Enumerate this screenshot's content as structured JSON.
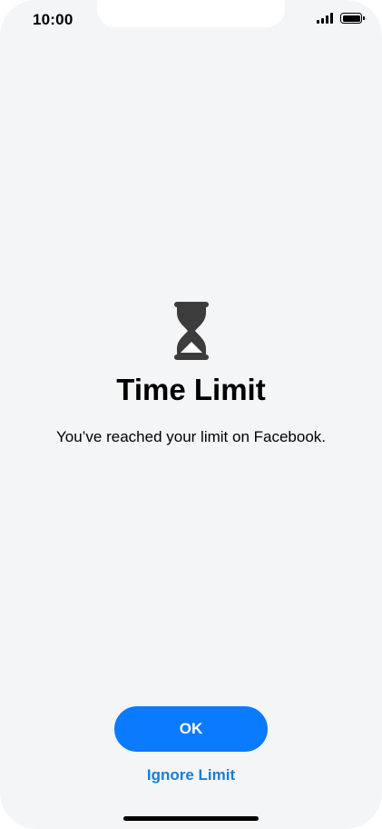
{
  "status_bar": {
    "time": "10:00",
    "signal_icon": "cellular-signal-icon",
    "battery_icon": "battery-icon"
  },
  "alert": {
    "icon": "hourglass-icon",
    "title": "Time Limit",
    "message": "You’ve reached your limit on Facebook."
  },
  "actions": {
    "ok_label": "OK",
    "ignore_label": "Ignore Limit"
  },
  "colors": {
    "background": "#f4f5f7",
    "accent": "#0a7aff",
    "link": "#1a7cd6",
    "icon": "#3c3c3c"
  }
}
